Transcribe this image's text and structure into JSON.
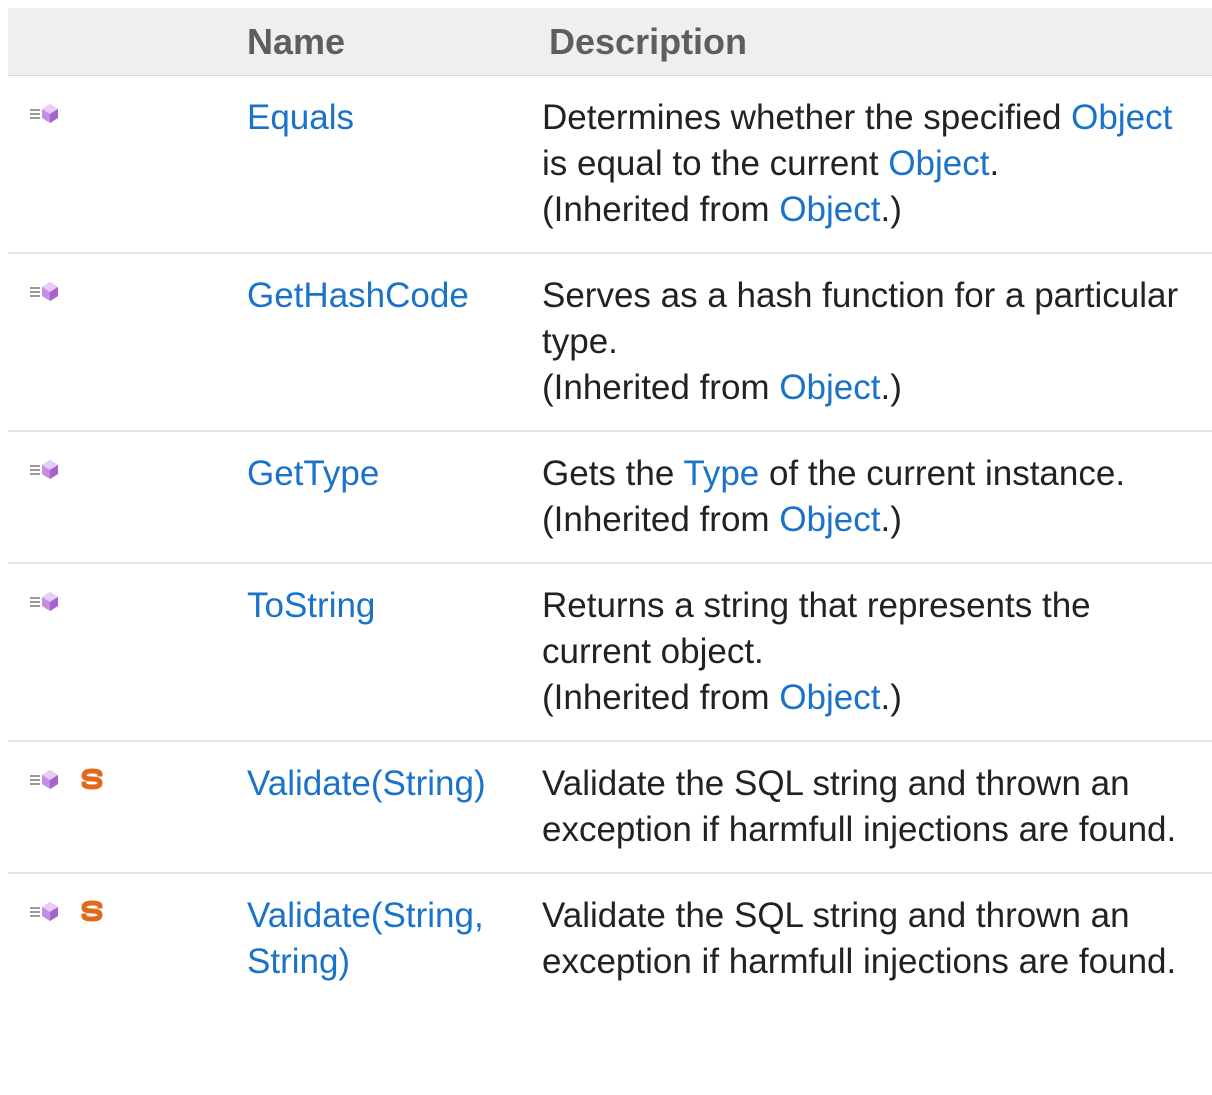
{
  "table": {
    "headers": {
      "icons": "",
      "name": "Name",
      "description": "Description"
    },
    "rows": [
      {
        "name": "Equals",
        "desc_1_before": "Determines whether the specified ",
        "desc_1_link_a": "Object",
        "desc_1_mid": " is equal to the current ",
        "desc_1_link_b": "Object",
        "desc_1_after": ".",
        "inherited_before": "(Inherited from ",
        "inherited_link": "Object",
        "inherited_after": ".)",
        "icons": [
          "public-method-icon"
        ]
      },
      {
        "name": "GetHashCode",
        "desc": "Serves as a hash function for a particular type.",
        "inherited_before": "(Inherited from ",
        "inherited_link": "Object",
        "inherited_after": ".)",
        "icons": [
          "public-method-icon"
        ]
      },
      {
        "name": "GetType",
        "desc_before": "Gets the ",
        "desc_link": "Type",
        "desc_after": " of the current instance.",
        "inherited_before": "(Inherited from ",
        "inherited_link": "Object",
        "inherited_after": ".)",
        "icons": [
          "public-method-icon"
        ]
      },
      {
        "name": "ToString",
        "desc": "Returns a string that represents the current object.",
        "inherited_before": "(Inherited from ",
        "inherited_link": "Object",
        "inherited_after": ".)",
        "icons": [
          "public-method-icon"
        ]
      },
      {
        "name": "Validate(String)",
        "desc": "Validate the SQL string and thrown an exception if harmfull injections are found.",
        "icons": [
          "public-method-icon",
          "static-icon"
        ]
      },
      {
        "name": "Validate(String, String)",
        "desc": "Validate the SQL string and thrown an exception if harmfull injections are found.",
        "icons": [
          "public-method-icon",
          "static-icon"
        ]
      }
    ]
  },
  "colors": {
    "link": "#1a73c8",
    "header_bg": "#efefef",
    "header_text": "#5e5e5e",
    "row_divider": "#e3e3e3",
    "method_icon": "#c28fe0",
    "static_icon": "#e06a1a"
  }
}
